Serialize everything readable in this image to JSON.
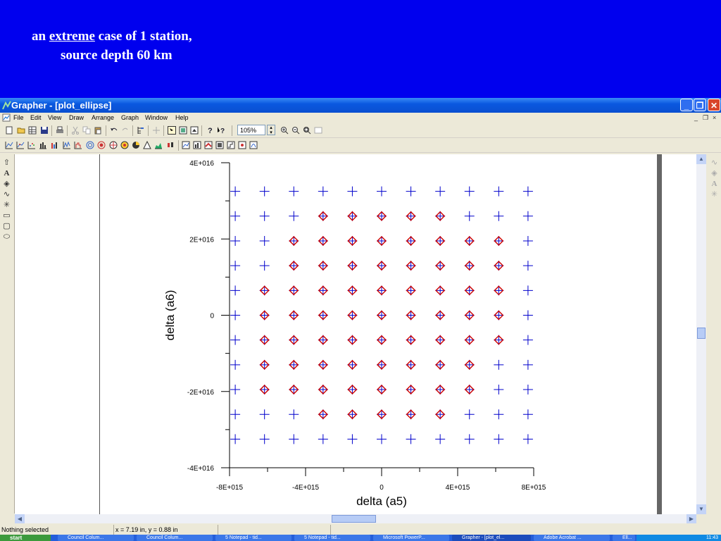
{
  "slide": {
    "line1_prefix": "an ",
    "line1_emph": "extreme",
    "line1_suffix": " case of 1 station,",
    "line2": "source depth 60  km"
  },
  "window": {
    "title": "Grapher - [plot_ellipse]",
    "controls": {
      "minimize": "_",
      "restore": "❐",
      "close": "✕"
    }
  },
  "menu": [
    "File",
    "Edit",
    "View",
    "Draw",
    "Arrange",
    "Graph",
    "Window",
    "Help"
  ],
  "child_window_controls": [
    "_",
    "❐",
    "×"
  ],
  "toolbar": {
    "zoom_value": "105%"
  },
  "statusbar": {
    "selection": "Nothing selected",
    "cursor": "x = 7.19 in, y = 0.88 in"
  },
  "taskbar": {
    "start_label": "start",
    "tasks": [
      "Council Colum...",
      "Council Colum...",
      "5 Notepad - tid...",
      "5 Notepad - tid...",
      "Microsoft PowerP...",
      "Grapher - [plot_el...",
      "Adobe Acrobat ...",
      "Ell..."
    ],
    "clock": "11:43"
  },
  "colors": {
    "slide_bg": "#0000ee",
    "grid_marker": "#0000cc",
    "selected_marker": "#cc0000"
  },
  "chart_data": {
    "type": "scatter",
    "xlabel": "delta (a5)",
    "ylabel": "delta (a6)",
    "xlim": [
      -8000000000000000.0,
      8000000000000000.0
    ],
    "ylim": [
      -4e+16,
      4e+16
    ],
    "x_ticks": [
      -8000000000000000.0,
      -4000000000000000.0,
      0,
      4000000000000000.0,
      8000000000000000.0
    ],
    "x_tick_labels": [
      "-8E+015",
      "-4E+015",
      "0",
      "4E+015",
      "8E+015"
    ],
    "y_ticks": [
      -4e+16,
      -2e+16,
      0,
      2e+16,
      4e+16
    ],
    "y_tick_labels": [
      "-4E+016",
      "-2E+016",
      "0",
      "2E+016",
      "4E+016"
    ],
    "grid": false,
    "series": [
      {
        "marker": "plus",
        "color": "#0000cc",
        "x_values": [
          -7700000000000000.0,
          -6160000000000000.0,
          -4620000000000000.0,
          -3080000000000000.0,
          -1540000000000000.0,
          0,
          1540000000000000.0,
          3080000000000000.0,
          4620000000000000.0,
          6160000000000000.0,
          7700000000000000.0
        ],
        "y_values": [
          3.25e+16,
          2.6e+16,
          1.95e+16,
          1.3e+16,
          6500000000000000.0,
          0,
          -6500000000000000.0,
          -1.3e+16,
          -1.95e+16,
          -2.6e+16,
          -3.25e+16
        ]
      },
      {
        "marker": "diamond",
        "color": "#cc0000",
        "x_values": [
          -7700000000000000.0,
          -6160000000000000.0,
          -4620000000000000.0,
          -3080000000000000.0,
          -1540000000000000.0,
          0,
          1540000000000000.0,
          3080000000000000.0,
          4620000000000000.0,
          6160000000000000.0,
          7700000000000000.0
        ],
        "y_values": [
          3.25e+16,
          2.6e+16,
          1.95e+16,
          1.3e+16,
          6500000000000000.0,
          0,
          -6500000000000000.0,
          -1.3e+16,
          -1.95e+16,
          -2.6e+16,
          -3.25e+16
        ],
        "rows_selected_columns": [
          [],
          [
            3,
            7
          ],
          [
            2,
            9
          ],
          [
            2,
            9
          ],
          [
            1,
            9
          ],
          [
            1,
            9
          ],
          [
            1,
            9
          ],
          [
            1,
            8
          ],
          [
            1,
            8
          ],
          [
            3,
            7
          ],
          []
        ]
      }
    ]
  }
}
